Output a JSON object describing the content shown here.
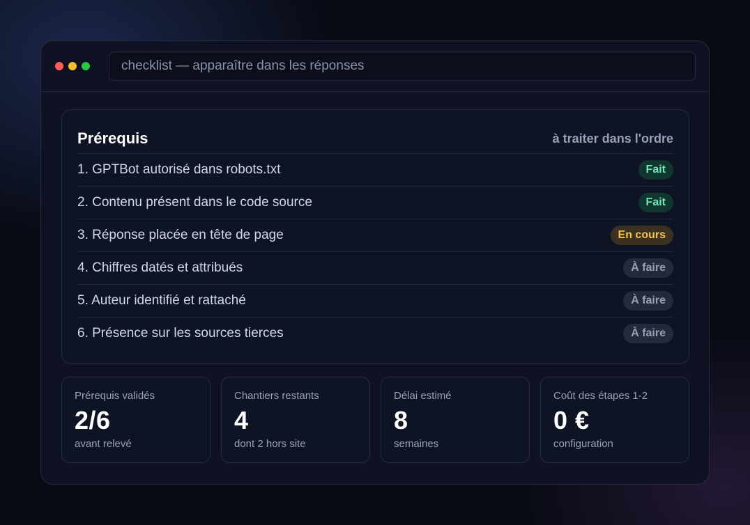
{
  "window": {
    "address": "checklist — apparaître dans les réponses",
    "dots": [
      "#ff5f57",
      "#febc2e",
      "#28c840"
    ]
  },
  "checklist": {
    "title": "Prérequis",
    "subtitle": "à traiter dans l'ordre",
    "items": [
      {
        "label": "1. GPTBot autorisé dans robots.txt",
        "status": "Fait",
        "status_type": "done"
      },
      {
        "label": "2. Contenu présent dans le code source",
        "status": "Fait",
        "status_type": "done"
      },
      {
        "label": "3. Réponse placée en tête de page",
        "status": "En cours",
        "status_type": "progress"
      },
      {
        "label": "4. Chiffres datés et attribués",
        "status": "À faire",
        "status_type": "todo"
      },
      {
        "label": "5. Auteur identifié et rattaché",
        "status": "À faire",
        "status_type": "todo"
      },
      {
        "label": "6. Présence sur les sources tierces",
        "status": "À faire",
        "status_type": "todo"
      }
    ]
  },
  "status_colors": {
    "done": {
      "bg": "#10362d",
      "fg": "#6ee7b7"
    },
    "progress": {
      "bg": "#3a3120",
      "fg": "#f5c451"
    },
    "todo": {
      "bg": "#252a3a",
      "fg": "#9aa0b8"
    }
  },
  "stats": [
    {
      "label": "Prérequis validés",
      "value": "2/6",
      "note": "avant relevé"
    },
    {
      "label": "Chantiers restants",
      "value": "4",
      "note": "dont 2 hors site"
    },
    {
      "label": "Délai estimé",
      "value": "8",
      "note": "semaines"
    },
    {
      "label": "Coût des étapes 1-2",
      "value": "0 €",
      "note": "configuration"
    }
  ]
}
